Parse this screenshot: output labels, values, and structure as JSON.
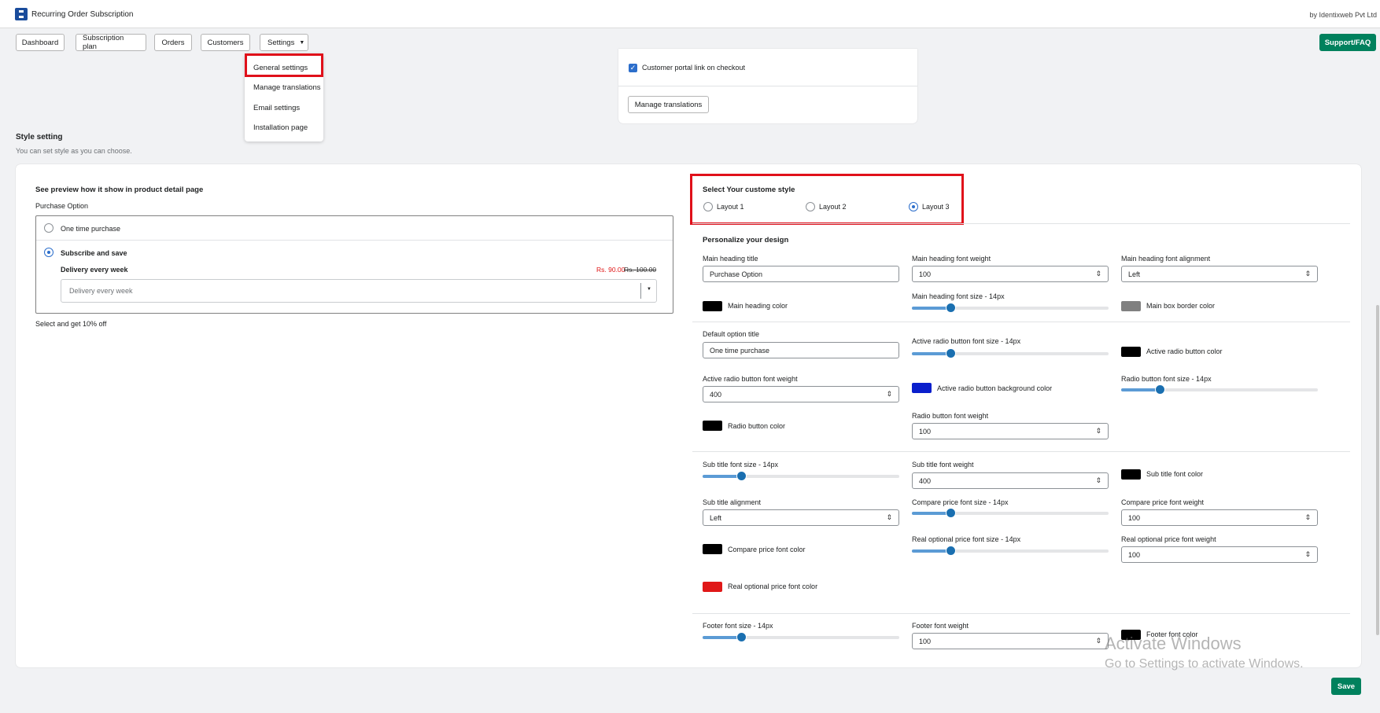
{
  "app": {
    "title": "Recurring Order Subscription",
    "vendor": "by Identixweb Pvt Ltd"
  },
  "nav": {
    "dashboard": "Dashboard",
    "subscription_plan": "Subscription plan",
    "orders": "Orders",
    "customers": "Customers",
    "settings": "Settings",
    "support": "Support/FAQ"
  },
  "settings_menu": {
    "general": "General settings",
    "translations": "Manage translations",
    "email": "Email settings",
    "installation": "Installation page"
  },
  "top_card": {
    "checkbox_label": "Customer portal link on checkout",
    "checkbox_checked": true,
    "manage_translations_button": "Manage translations"
  },
  "style_section": {
    "title": "Style setting",
    "subtitle": "You can set style as you can choose."
  },
  "preview": {
    "heading": "See preview how it show in product detail page",
    "main_title": "Purchase Option",
    "option_one_time": "One time purchase",
    "option_subscribe": "Subscribe and save",
    "delivery_label": "Delivery every week",
    "price": "Rs. 90.00",
    "compare_price": "Rs. 100.00",
    "select_value": "Delivery every week",
    "footer": "Select and get 10% off"
  },
  "layout_select": {
    "title": "Select Your custome style",
    "options": [
      "Layout 1",
      "Layout 2",
      "Layout 3"
    ],
    "selected": "Layout 3"
  },
  "design": {
    "title": "Personalize your design",
    "main_heading_title_label": "Main heading title",
    "main_heading_title_value": "Purchase Option",
    "main_heading_font_weight_label": "Main heading font weight",
    "main_heading_font_weight_value": "100",
    "main_heading_alignment_label": "Main heading font alignment",
    "main_heading_alignment_value": "Left",
    "main_heading_color_label": "Main heading color",
    "main_heading_font_size_label": "Main heading font size - 14px",
    "main_box_border_color_label": "Main box border color",
    "default_option_title_label": "Default option title",
    "default_option_title_value": "One time purchase",
    "active_radio_font_size_label": "Active radio button font size - 14px",
    "active_radio_color_label": "Active radio button color",
    "active_radio_font_weight_label": "Active radio button font weight",
    "active_radio_font_weight_value": "400",
    "active_radio_bg_color_label": "Active radio button background color",
    "radio_font_size_label": "Radio button font size - 14px",
    "radio_color_label": "Radio button color",
    "radio_font_weight_label": "Radio button font weight",
    "radio_font_weight_value": "100",
    "sub_title_font_size_label": "Sub title font size - 14px",
    "sub_title_font_weight_label": "Sub title font weight",
    "sub_title_font_weight_value": "400",
    "sub_title_font_color_label": "Sub title font color",
    "sub_title_alignment_label": "Sub title alignment",
    "sub_title_alignment_value": "Left",
    "compare_price_font_size_label": "Compare price font size - 14px",
    "compare_price_font_weight_label": "Compare price font weight",
    "compare_price_font_weight_value": "100",
    "compare_price_font_color_label": "Compare price font color",
    "real_price_font_size_label": "Real optional price font size - 14px",
    "real_price_font_weight_label": "Real optional price font weight",
    "real_price_font_weight_value": "100",
    "real_price_font_color_label": "Real optional price font color",
    "footer_font_size_label": "Footer font size - 14px",
    "footer_font_weight_label": "Footer font weight",
    "footer_font_weight_value": "100",
    "footer_font_color_label": "Footer font color"
  },
  "colors": {
    "main_heading": "#000000",
    "main_box_border": "#808080",
    "active_radio": "#000000",
    "active_radio_bg": "#0a1fcc",
    "radio": "#000000",
    "sub_title": "#000000",
    "compare_price": "#000000",
    "real_price": "#e01818",
    "footer": "#000000"
  },
  "save_button": "Save",
  "watermark": {
    "line1": "Activate Windows",
    "line2": "Go to Settings to activate Windows."
  }
}
